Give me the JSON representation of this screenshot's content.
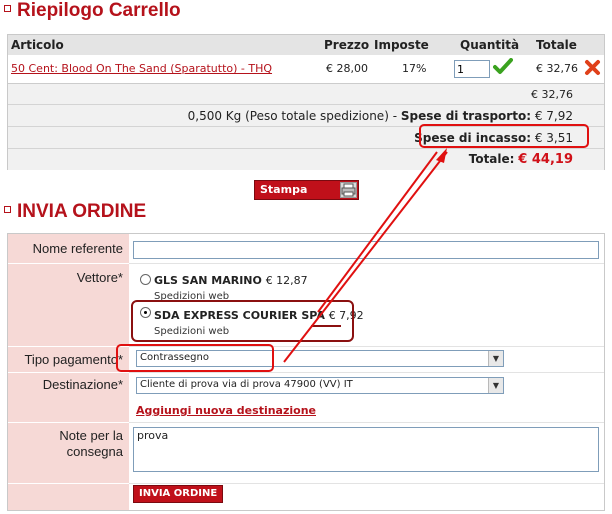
{
  "cart_section": {
    "title": "Riepilogo Carrello"
  },
  "cart": {
    "headers": {
      "article": "Articolo",
      "price": "Prezzo",
      "taxes": "Imposte",
      "quantity": "Quantità",
      "total": "Totale"
    },
    "item": {
      "name": "50 Cent: Blood On The Sand (Sparatutto) - THQ",
      "price": "€ 28,00",
      "tax": "17%",
      "quantity": "1",
      "total": "€ 32,76"
    },
    "subtotal": "€ 32,76",
    "shipping": {
      "weight_text": "0,500 Kg (Peso totale spedizione) -",
      "label": "Spese di trasporto:",
      "amount": "€ 7,92"
    },
    "cod": {
      "label": "Spese di incasso:",
      "amount": "€ 3,51"
    },
    "grand_total": {
      "label": "Totale:",
      "amount": "€ 44,19"
    },
    "print_button": "Stampa"
  },
  "order_section": {
    "title": "INVIA ORDINE"
  },
  "order_form": {
    "reference_label": "Nome referente",
    "reference_value": "",
    "carrier_label": "Vettore*",
    "carriers": [
      {
        "name": "GLS SAN MARINO",
        "price": "€ 12,87",
        "note": "Spedizioni web",
        "selected": false
      },
      {
        "name": "SDA EXPRESS COURIER SPA",
        "price": "€ 7,92",
        "note": "Spedizioni web",
        "selected": true
      }
    ],
    "payment_label": "Tipo pagamento*",
    "payment_value": "Contrassegno",
    "destination_label": "Destinazione*",
    "destination_value": "Cliente di prova via di prova 47900 (VV) IT",
    "add_destination": "Aggiungi nuova destinazione",
    "notes_label_1": "Note per la",
    "notes_label_2": "consegna",
    "notes_value": "prova",
    "submit_button": "INVIA ORDINE"
  },
  "colors": {
    "brand_red": "#b5121b",
    "label_bg": "#f6d9d6",
    "annotation_red": "#e01010",
    "annotation_dark_red": "#8b1010"
  },
  "icons": {
    "confirm": "checkmark-icon",
    "remove": "delete-x-icon",
    "print": "print-icon"
  }
}
